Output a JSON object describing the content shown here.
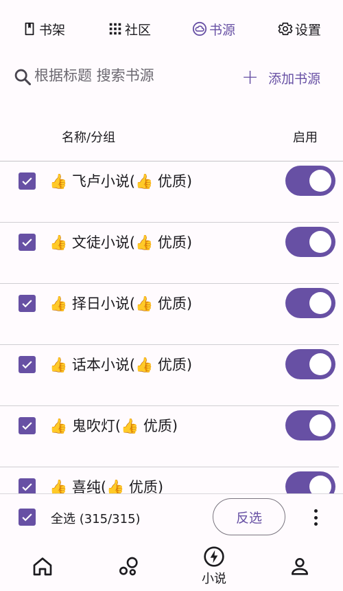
{
  "top_tabs": [
    {
      "label": "书架",
      "icon": "book-icon"
    },
    {
      "label": "社区",
      "icon": "grid-icon"
    },
    {
      "label": "书源",
      "icon": "cloud-icon",
      "active": true
    },
    {
      "label": "设置",
      "icon": "gear-icon"
    }
  ],
  "search": {
    "placeholder": "根据标题 搜索书源"
  },
  "add_source_label": "添加书源",
  "list_header": {
    "name": "名称/分组",
    "enabled": "启用"
  },
  "sources": [
    {
      "name": "👍 飞卢小说(👍 优质)",
      "checked": true,
      "enabled": true
    },
    {
      "name": "👍 文徒小说(👍 优质)",
      "checked": true,
      "enabled": true
    },
    {
      "name": "👍 择日小说(👍 优质)",
      "checked": true,
      "enabled": true
    },
    {
      "name": "👍 话本小说(👍 优质)",
      "checked": true,
      "enabled": true
    },
    {
      "name": "👍 鬼吹灯(👍 优质)",
      "checked": true,
      "enabled": true
    },
    {
      "name": "👍 喜纯(👍 优质)",
      "checked": true,
      "enabled": true
    }
  ],
  "select_bar": {
    "select_all_label": "全选 (315/315)",
    "invert_label": "反选"
  },
  "bottom_nav": [
    {
      "icon": "home-icon",
      "label": ""
    },
    {
      "icon": "bubbles-icon",
      "label": ""
    },
    {
      "icon": "lightning-icon",
      "label": "小说"
    },
    {
      "icon": "person-icon",
      "label": ""
    }
  ],
  "colors": {
    "accent": "#6750a4",
    "background": "#fffbfe",
    "text": "#1c1b1f"
  }
}
